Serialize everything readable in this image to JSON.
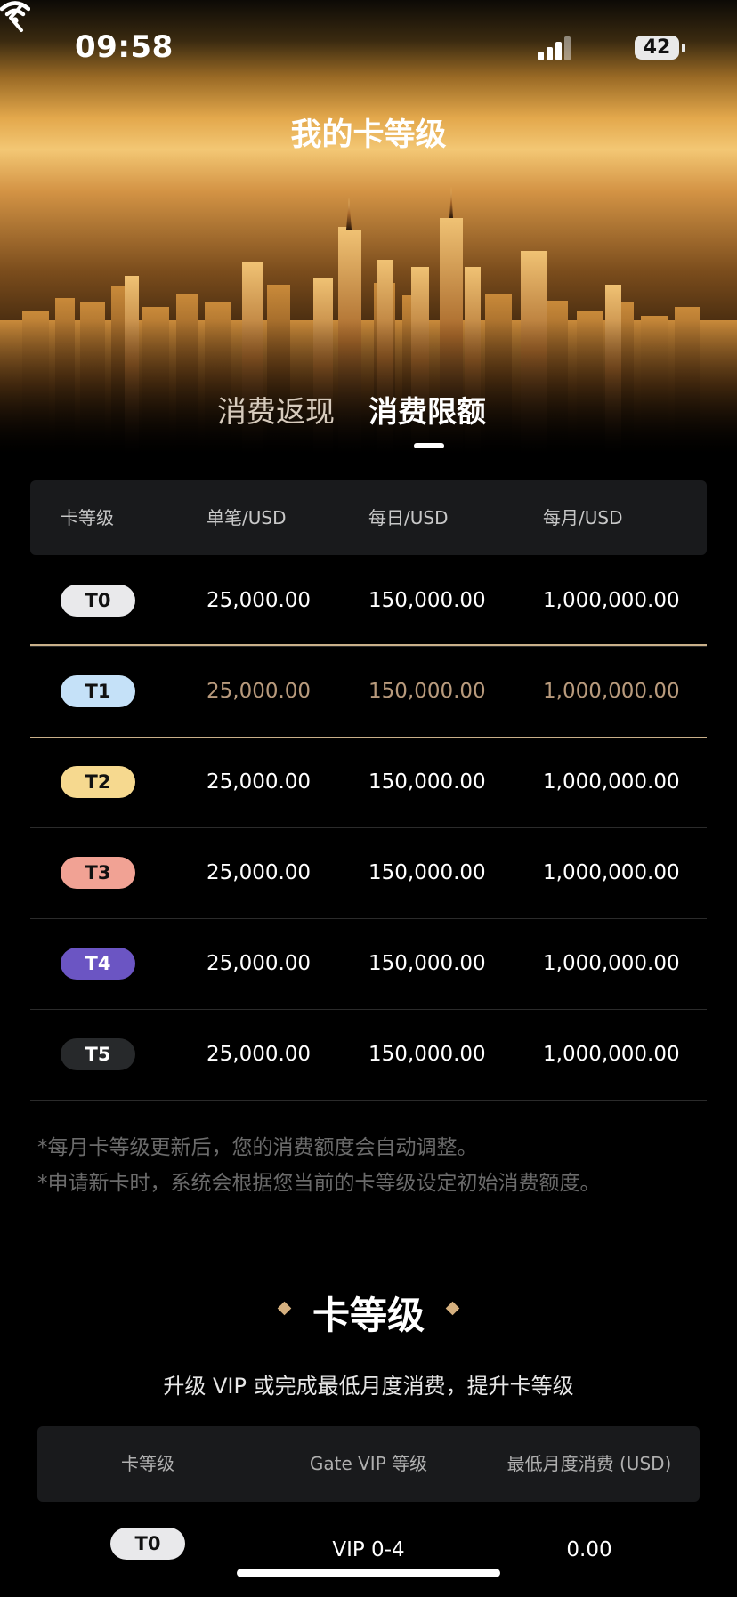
{
  "status_bar": {
    "time": "09:58",
    "battery": "42"
  },
  "header": {
    "title": "我的卡等级"
  },
  "tabs": [
    {
      "label": "消费返现",
      "active": false
    },
    {
      "label": "消费限额",
      "active": true
    }
  ],
  "limits_table": {
    "headers": [
      "卡等级",
      "单笔/USD",
      "每日/USD",
      "每月/USD"
    ],
    "rows": [
      {
        "tier": "T0",
        "single": "25,000.00",
        "daily": "150,000.00",
        "monthly": "1,000,000.00",
        "badge_color": "#e9e9eb",
        "badge_text_color": "#111111"
      },
      {
        "tier": "T1",
        "single": "25,000.00",
        "daily": "150,000.00",
        "monthly": "1,000,000.00",
        "badge_color": "#c5e1f8",
        "badge_text_color": "#111111",
        "current": true
      },
      {
        "tier": "T2",
        "single": "25,000.00",
        "daily": "150,000.00",
        "monthly": "1,000,000.00",
        "badge_color": "#f6d98f",
        "badge_text_color": "#111111"
      },
      {
        "tier": "T3",
        "single": "25,000.00",
        "daily": "150,000.00",
        "monthly": "1,000,000.00",
        "badge_color": "#f1a294",
        "badge_text_color": "#111111"
      },
      {
        "tier": "T4",
        "single": "25,000.00",
        "daily": "150,000.00",
        "monthly": "1,000,000.00",
        "badge_color": "#6b55c3",
        "badge_text_color": "#ffffff"
      },
      {
        "tier": "T5",
        "single": "25,000.00",
        "daily": "150,000.00",
        "monthly": "1,000,000.00",
        "badge_color": "#27292b",
        "badge_text_color": "#ffffff"
      }
    ]
  },
  "notes": [
    "*每月卡等级更新后，您的消费额度会自动调整。",
    "*申请新卡时，系统会根据您当前的卡等级设定初始消费额度。"
  ],
  "tier_section": {
    "title": "卡等级",
    "subtitle": "升级 VIP 或完成最低月度消费，提升卡等级",
    "headers": [
      "卡等级",
      "Gate VIP 等级",
      "最低月度消费 (USD)"
    ],
    "rows": [
      {
        "tier": "T0",
        "vip": "VIP 0-4",
        "min_spend": "0.00",
        "badge_color": "#e9e9eb",
        "badge_text_color": "#111111"
      }
    ]
  },
  "colors": {
    "accent_gold": "#c9b08a",
    "current_row_text": "#b89a7c"
  }
}
